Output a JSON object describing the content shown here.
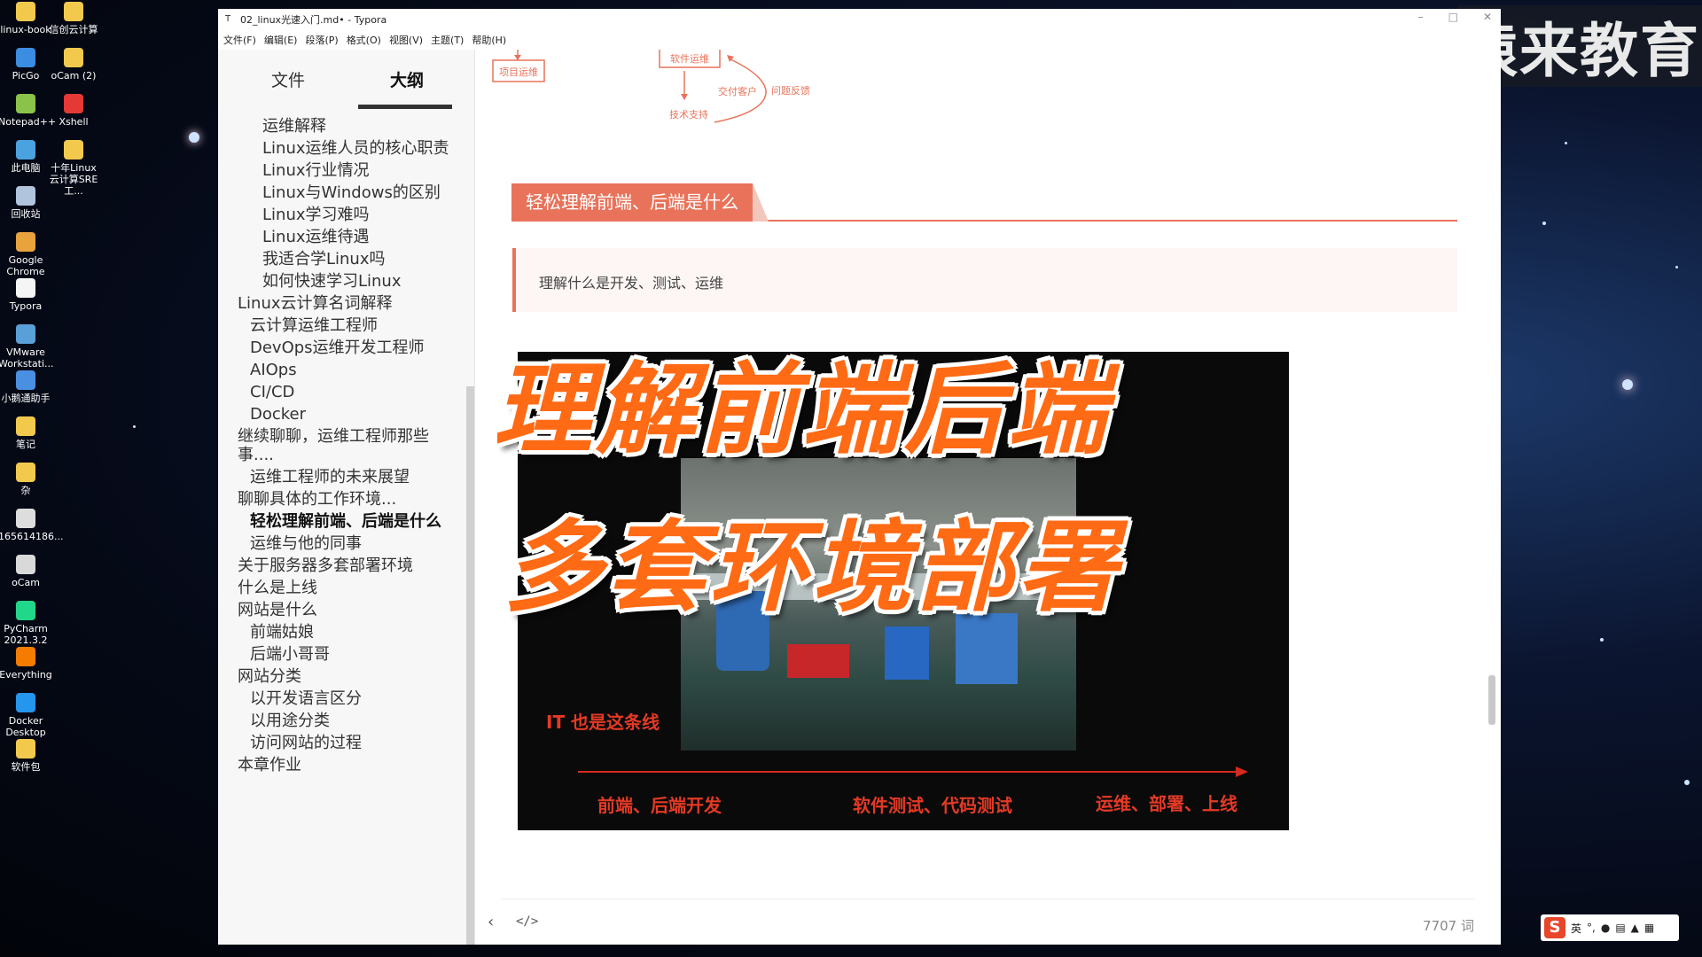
{
  "desktop_icons": [
    {
      "label": "linux-book",
      "icon": "folder-icon"
    },
    {
      "label": "信创云计算",
      "icon": "folder-icon"
    },
    {
      "label": "PicGo",
      "icon": "picgo-icon"
    },
    {
      "label": "oCam (2)",
      "icon": "folder-icon"
    },
    {
      "label": "Notepad++",
      "icon": "notepad-icon"
    },
    {
      "label": "Xshell",
      "icon": "xshell-icon"
    },
    {
      "label": "此电脑",
      "icon": "computer-icon"
    },
    {
      "label": "十年Linux云计算SRE工...",
      "icon": "folder-icon"
    },
    {
      "label": "回收站",
      "icon": "recycle-bin-icon"
    },
    {
      "label": "Google Chrome",
      "icon": "chrome-icon"
    },
    {
      "label": "Typora",
      "icon": "typora-icon"
    },
    {
      "label": "VMware Workstati...",
      "icon": "vmware-icon"
    },
    {
      "label": "小鹅通助手",
      "icon": "helper-icon"
    },
    {
      "label": "笔记",
      "icon": "folder-icon"
    },
    {
      "label": "杂",
      "icon": "folder-icon"
    },
    {
      "label": "165614186...",
      "icon": "file-icon"
    },
    {
      "label": "oCam",
      "icon": "ocam-icon"
    },
    {
      "label": "PyCharm 2021.3.2",
      "icon": "pycharm-icon"
    },
    {
      "label": "Everything",
      "icon": "everything-icon"
    },
    {
      "label": "Docker Desktop",
      "icon": "docker-icon"
    },
    {
      "label": "软件包",
      "icon": "folder-icon"
    }
  ],
  "watermark": "猿来教育",
  "window": {
    "title": "02_linux光速入门.md• - Typora",
    "menu": [
      "文件(F)",
      "编辑(E)",
      "段落(P)",
      "格式(O)",
      "视图(V)",
      "主题(T)",
      "帮助(H)"
    ]
  },
  "sidebar": {
    "tabs": [
      "文件",
      "大纲"
    ],
    "active_tab": "大纲",
    "outline": [
      {
        "text": "运维解释",
        "level": 3
      },
      {
        "text": "Linux运维人员的核心职责",
        "level": 3
      },
      {
        "text": "Linux行业情况",
        "level": 3
      },
      {
        "text": "Linux与Windows的区别",
        "level": 3
      },
      {
        "text": "Linux学习难吗",
        "level": 3
      },
      {
        "text": "Linux运维待遇",
        "level": 3
      },
      {
        "text": "我适合学Linux吗",
        "level": 3
      },
      {
        "text": "如何快速学习Linux",
        "level": 3
      },
      {
        "text": "Linux云计算名词解释",
        "level": 1
      },
      {
        "text": "云计算运维工程师",
        "level": 2
      },
      {
        "text": "DevOps运维开发工程师",
        "level": 2
      },
      {
        "text": "AIOps",
        "level": 2
      },
      {
        "text": "CI/CD",
        "level": 2
      },
      {
        "text": "Docker",
        "level": 2
      },
      {
        "text": "继续聊聊，运维工程师那些事....",
        "level": 1
      },
      {
        "text": "运维工程师的未来展望",
        "level": 2
      },
      {
        "text": "聊聊具体的工作环境...",
        "level": 1
      },
      {
        "text": "轻松理解前端、后端是什么",
        "level": 2,
        "active": true
      },
      {
        "text": "运维与他的同事",
        "level": 2
      },
      {
        "text": "关于服务器多套部署环境",
        "level": 1
      },
      {
        "text": "什么是上线",
        "level": 1
      },
      {
        "text": "网站是什么",
        "level": 1
      },
      {
        "text": "前端姑娘",
        "level": 2
      },
      {
        "text": "后端小哥哥",
        "level": 2
      },
      {
        "text": "网站分类",
        "level": 1
      },
      {
        "text": "以开发语言区分",
        "level": 2
      },
      {
        "text": "以用途分类",
        "level": 2
      },
      {
        "text": "访问网站的过程",
        "level": 2
      },
      {
        "text": "本章作业",
        "level": 1
      }
    ]
  },
  "content": {
    "diagram": {
      "node_project": "项目运维",
      "node_software": "软件运维",
      "label_deliver": "交付客户",
      "label_feedback": "问题反馈",
      "label_support": "技术支持"
    },
    "heading": "轻松理解前端、后端是什么",
    "quote": "理解什么是开发、测试、运维",
    "video": {
      "overlay_line1": "理解前端后端",
      "overlay_line2": "多套环境部署",
      "caption": "IT 也是这条线",
      "stage1": "前端、后端开发",
      "stage2": "软件测试、代码测试",
      "stage3": "运维、部署、上线"
    }
  },
  "status": {
    "word_count": "7707 词",
    "source_toggle": "</>"
  },
  "ime": {
    "lang": "英"
  },
  "colors": {
    "accent": "#e8735a",
    "overlay_orange": "#ff6a14",
    "video_red": "#e43a25"
  }
}
